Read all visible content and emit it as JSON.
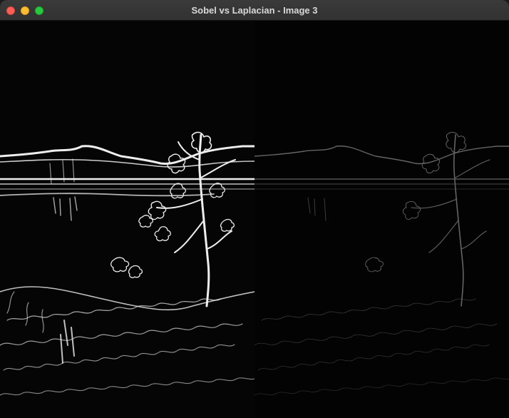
{
  "window": {
    "title": "Sobel vs Laplacian - Image 3",
    "buttons": {
      "close": "close-button",
      "minimize": "minimize-button",
      "zoom": "zoom-button"
    }
  },
  "images": [
    {
      "name": "sobel-result",
      "tone": "#eeeeee"
    },
    {
      "name": "laplacian-result",
      "tone": "#6f6f6f"
    }
  ]
}
